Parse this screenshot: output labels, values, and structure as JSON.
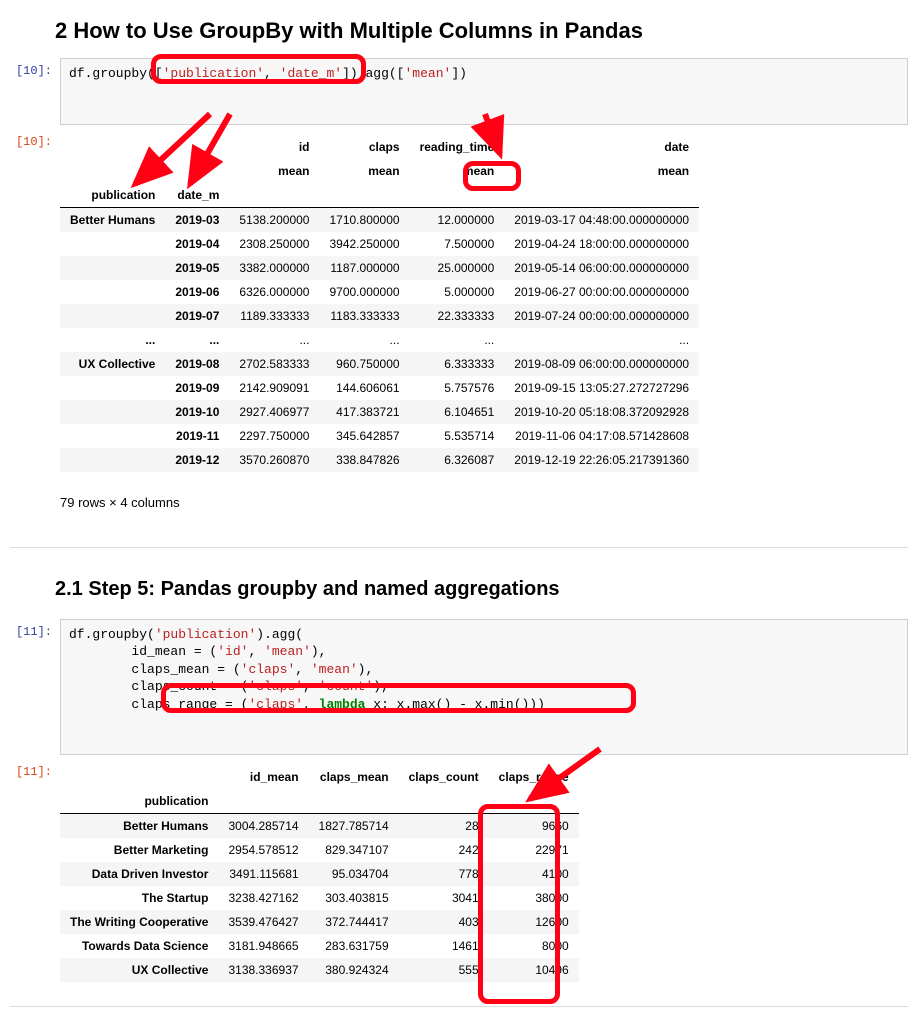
{
  "heading_main": "2  How to Use GroupBy with Multiple Columns in Pandas",
  "heading_sub": "2.1  Step 5: Pandas groupby and named aggregations",
  "cell10": {
    "in_prompt": "[10]:",
    "out_prompt": "[10]:",
    "code_prefix": "df.groupby([",
    "code_arg1": "'publication'",
    "code_comma": ", ",
    "code_arg2": "'date_m'",
    "code_mid": "]).agg([",
    "code_arg3": "'mean'",
    "code_suffix": "])",
    "headers_top": [
      "",
      "",
      "id",
      "claps",
      "reading_time",
      "date"
    ],
    "headers_mid": [
      "",
      "",
      "mean",
      "mean",
      "mean",
      "mean"
    ],
    "headers_idx": [
      "publication",
      "date_m",
      "",
      "",
      "",
      ""
    ],
    "rows": [
      [
        "Better Humans",
        "2019-03",
        "5138.200000",
        "1710.800000",
        "12.000000",
        "2019-03-17 04:48:00.000000000"
      ],
      [
        "",
        "2019-04",
        "2308.250000",
        "3942.250000",
        "7.500000",
        "2019-04-24 18:00:00.000000000"
      ],
      [
        "",
        "2019-05",
        "3382.000000",
        "1187.000000",
        "25.000000",
        "2019-05-14 06:00:00.000000000"
      ],
      [
        "",
        "2019-06",
        "6326.000000",
        "9700.000000",
        "5.000000",
        "2019-06-27 00:00:00.000000000"
      ],
      [
        "",
        "2019-07",
        "1189.333333",
        "1183.333333",
        "22.333333",
        "2019-07-24 00:00:00.000000000"
      ],
      [
        "...",
        "...",
        "...",
        "...",
        "...",
        "..."
      ],
      [
        "UX Collective",
        "2019-08",
        "2702.583333",
        "960.750000",
        "6.333333",
        "2019-08-09 06:00:00.000000000"
      ],
      [
        "",
        "2019-09",
        "2142.909091",
        "144.606061",
        "5.757576",
        "2019-09-15 13:05:27.272727296"
      ],
      [
        "",
        "2019-10",
        "2927.406977",
        "417.383721",
        "6.104651",
        "2019-10-20 05:18:08.372092928"
      ],
      [
        "",
        "2019-11",
        "2297.750000",
        "345.642857",
        "5.535714",
        "2019-11-06 04:17:08.571428608"
      ],
      [
        "",
        "2019-12",
        "3570.260870",
        "338.847826",
        "6.326087",
        "2019-12-19 22:26:05.217391360"
      ]
    ],
    "summary": "79 rows × 4 columns"
  },
  "cell11": {
    "in_prompt": "[11]:",
    "out_prompt": "[11]:",
    "code_l1a": "df.groupby(",
    "code_l1b": "'publication'",
    "code_l1c": ").agg(",
    "code_l2a": "        id_mean = (",
    "code_l2b": "'id'",
    "code_l2c": ", ",
    "code_l2d": "'mean'",
    "code_l2e": "),",
    "code_l3a": "        claps_mean = (",
    "code_l3b": "'claps'",
    "code_l3c": ", ",
    "code_l3d": "'mean'",
    "code_l3e": "),",
    "code_l4a": "        claps_count = (",
    "code_l4b": "'claps'",
    "code_l4c": ", ",
    "code_l4d": "'count'",
    "code_l4e": "),",
    "code_l5a": "        claps_range = (",
    "code_l5b": "'claps'",
    "code_l5c": ", ",
    "code_l5d": "lambda",
    "code_l5e": " x: x.max() - x.min()))",
    "headers": [
      "",
      "id_mean",
      "claps_mean",
      "claps_count",
      "claps_range"
    ],
    "idx_label": "publication",
    "rows": [
      [
        "Better Humans",
        "3004.285714",
        "1827.785714",
        "28",
        "9660"
      ],
      [
        "Better Marketing",
        "2954.578512",
        "829.347107",
        "242",
        "22971"
      ],
      [
        "Data Driven Investor",
        "3491.115681",
        "95.034704",
        "778",
        "4100"
      ],
      [
        "The Startup",
        "3238.427162",
        "303.403815",
        "3041",
        "38000"
      ],
      [
        "The Writing Cooperative",
        "3539.476427",
        "372.744417",
        "403",
        "12600"
      ],
      [
        "Towards Data Science",
        "3181.948665",
        "283.631759",
        "1461",
        "8000"
      ],
      [
        "UX Collective",
        "3138.336937",
        "380.924324",
        "555",
        "10496"
      ]
    ]
  }
}
